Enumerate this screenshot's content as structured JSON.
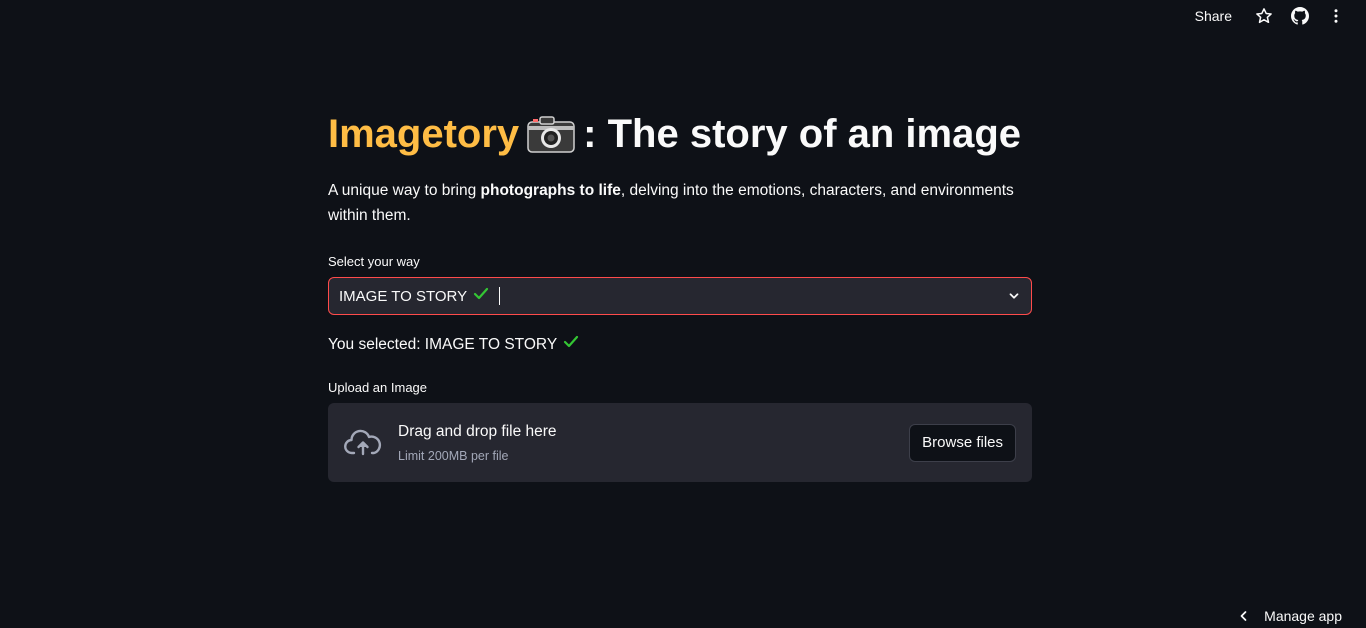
{
  "topbar": {
    "share_label": "Share",
    "icons": [
      "star-icon",
      "github-icon",
      "more-vertical-icon"
    ]
  },
  "header": {
    "title_brand": "Imagetory",
    "title_icon": "camera-icon",
    "title_rest": ": The story of an image"
  },
  "intro": {
    "text_before": "A unique way to bring ",
    "text_bold": "photographs to life",
    "text_after": ", delving into the emotions, characters, and environments within them."
  },
  "select": {
    "label": "Select your way",
    "value": "IMAGE TO STORY",
    "value_icon": "check-icon"
  },
  "selected_message": {
    "text": "You selected: IMAGE TO STORY",
    "icon": "check-icon"
  },
  "uploader": {
    "label": "Upload an Image",
    "drop_text": "Drag and drop file here",
    "limit_text": "Limit 200MB per file",
    "browse_label": "Browse files"
  },
  "footer": {
    "manage_label": "Manage app"
  },
  "colors": {
    "background": "#0e1117",
    "brand": "#ffbd45",
    "accent_border": "#ff4b4b",
    "check": "#34c634",
    "surface": "#262730"
  }
}
